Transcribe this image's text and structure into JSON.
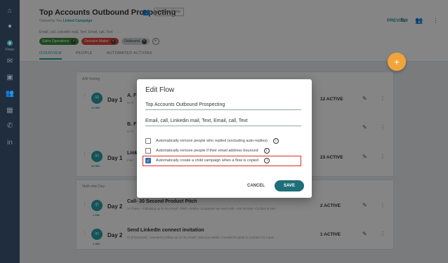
{
  "header": {
    "title": "Top Accounts Outbound Prospecting",
    "master_flow": "Master Flow",
    "owned_prefix": "Owned by You",
    "owned_campaign": "Linked Campaign",
    "steps_summary": "Email, call, LinkedIn mail, Text, Email, call, Text",
    "chips": [
      "Sales Operations",
      "Decision Maker",
      "Outbound"
    ],
    "preview": "PREVIEW",
    "tabs": [
      "OVERVIEW",
      "PEOPLE",
      "AUTOMATED ACTIONS"
    ]
  },
  "fab_label": "+",
  "card1": {
    "label": "A/B Testing",
    "rows": [
      {
        "day": "Day 1",
        "title": "A. F",
        "desc": "Hi Fi",
        "sub": "12 INK",
        "active": "12 ACTIVE"
      },
      {
        "day": "",
        "title": "B. F",
        "desc": "Hi Fi",
        "sub": "",
        "active": ""
      },
      {
        "day": "Day 1",
        "title": "Link",
        "desc": "Find",
        "sub": "23 INK",
        "active": "23 ACTIVE"
      }
    ]
  },
  "card2": {
    "label": "Multi-step Day",
    "rows": [
      {
        "day": "Day 2",
        "title": "Call- 30 Second Product Pitch",
        "desc": "Hi There – Following up to my email - Pitch- Similar companies we work with - Ask for time -Confirm & Sen",
        "sub": "2 INK",
        "active": "2 ACTIVE"
      },
      {
        "day": "Day 2",
        "title": "Send LinkedIn connect invitation",
        "desc": "Hi {Firstname}, I wanted to follow up on my email I sent you earlier. It would be great to connect on a quic",
        "sub": "1 INK",
        "active": "1 ACTIVE"
      }
    ]
  },
  "dialog": {
    "title": "Edit Flow",
    "name_value": "Top Accounts Outbound Prospecting",
    "steps_value": "Email, call, Linkedin mail, Text, Email, call, Text",
    "options": [
      {
        "label": "Automatically remove people who replied (excluding auto-replies)",
        "checked": false
      },
      {
        "label": "Automatically remove people if their email address bounced",
        "checked": false
      },
      {
        "label": "Automatically create a child campaign when a flow is copied",
        "checked": true
      }
    ],
    "cancel": "CANCEL",
    "save": "SAVE"
  },
  "colors": {
    "accent": "#2aa0a8",
    "save_button": "#1f6f78",
    "fab": "#f1a43a",
    "highlight": "#d82c2c",
    "nav": "#1f2d3d"
  },
  "icons": {
    "nav": [
      "home-icon",
      "circle-icon",
      "compass-icon",
      "mail-icon",
      "briefcase-icon",
      "people-icon",
      "grid-icon",
      "phone-icon",
      "linkedin-icon"
    ],
    "rail_label": "Flows"
  }
}
